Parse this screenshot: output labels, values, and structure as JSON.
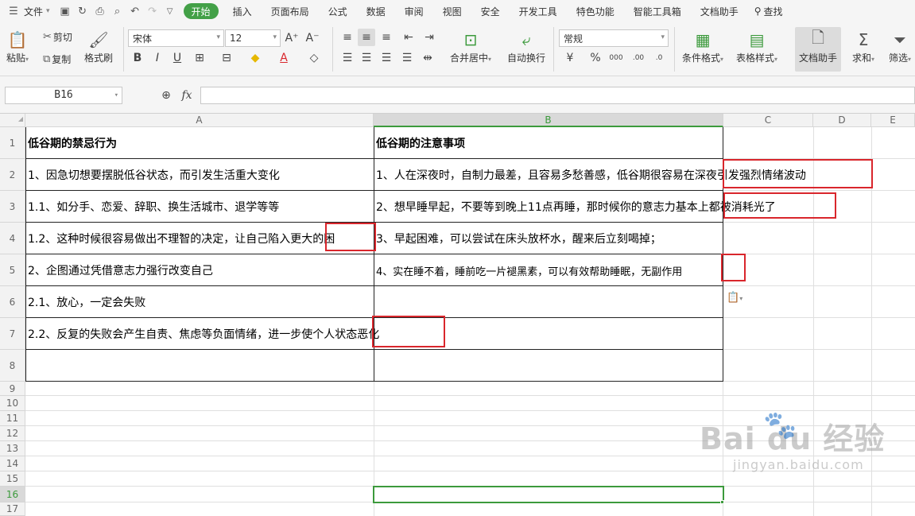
{
  "menu": {
    "file": "文件",
    "tabs": [
      "开始",
      "插入",
      "页面布局",
      "公式",
      "数据",
      "审阅",
      "视图",
      "安全",
      "开发工具",
      "特色功能",
      "智能工具箱",
      "文档助手"
    ],
    "search": "查找"
  },
  "ribbon": {
    "paste": "粘贴",
    "cut": "剪切",
    "copy": "复制",
    "format_painter": "格式刷",
    "font_name": "宋体",
    "font_size": "12",
    "merge_center": "合并居中",
    "wrap": "自动换行",
    "number_format": "常规",
    "conditional": "条件格式",
    "table_style": "表格样式",
    "doc_assist": "文档助手",
    "sum": "求和",
    "filter": "筛选"
  },
  "formula": {
    "cell_ref": "B16",
    "fx": "fx",
    "value": ""
  },
  "columns": [
    "A",
    "B",
    "C",
    "D",
    "E"
  ],
  "rows": [
    "1",
    "2",
    "3",
    "4",
    "5",
    "6",
    "7",
    "8",
    "9",
    "10",
    "11",
    "12",
    "13",
    "14",
    "15",
    "16",
    "17"
  ],
  "cells": {
    "A1": "低谷期的禁忌行为",
    "B1": "低谷期的注意事项",
    "A2": "1、因急切想要摆脱低谷状态，而引发生活重大变化",
    "B2": "1、人在深夜时，自制力最差，且容易多愁善感，低谷期很容易在深夜引发强烈情绪波动",
    "A3": "1.1、如分手、恋爱、辞职、换生活城市、退学等等",
    "B3": "2、想早睡早起，不要等到晚上11点再睡，那时候你的意志力基本上都被消耗光了",
    "A4": "1.2、这种时候很容易做出不理智的决定，让自己陷入更大的困",
    "B4": "3、早起困难，可以尝试在床头放杯水，醒来后立刻喝掉；",
    "A5": "2、企图通过凭借意志力强行改变自己",
    "B5": "4、实在睡不着，睡前吃一片褪黑素，可以有效帮助睡眠，无副作用",
    "A6": "2.1、放心，一定会失败",
    "A7": "2.2、反复的失败会产生自责、焦虑等负面情绪，进一步使个人状态恶化"
  },
  "watermark": {
    "brand": "Bai du 经验",
    "url": "jingyan.baidu.com"
  }
}
